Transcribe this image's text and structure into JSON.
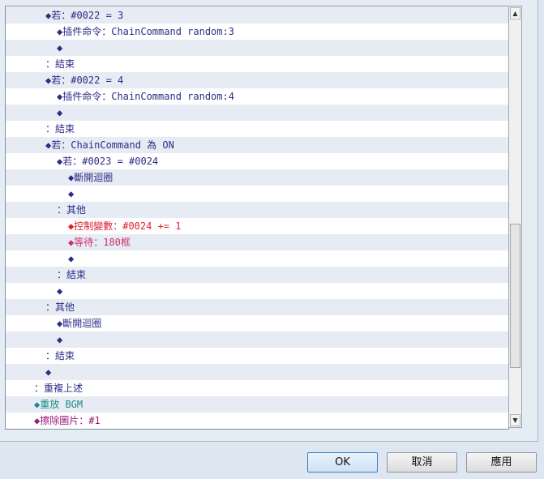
{
  "event_commands": [
    {
      "indent": 56,
      "text": "◆若：#0022 = 3",
      "color": "navy",
      "bg": "alt"
    },
    {
      "indent": 70,
      "text": "◆插件命令：ChainCommand random:3",
      "color": "navy",
      "bg": "plain"
    },
    {
      "indent": 70,
      "text": "◆",
      "color": "navy",
      "bg": "alt"
    },
    {
      "indent": 56,
      "text": "：結束",
      "color": "navy",
      "bg": "plain"
    },
    {
      "indent": 56,
      "text": "◆若：#0022 = 4",
      "color": "navy",
      "bg": "alt"
    },
    {
      "indent": 70,
      "text": "◆插件命令：ChainCommand random:4",
      "color": "navy",
      "bg": "plain"
    },
    {
      "indent": 70,
      "text": "◆",
      "color": "navy",
      "bg": "alt"
    },
    {
      "indent": 56,
      "text": "：結束",
      "color": "navy",
      "bg": "plain"
    },
    {
      "indent": 56,
      "text": "◆若：ChainCommand 為 ON",
      "color": "navy",
      "bg": "alt"
    },
    {
      "indent": 70,
      "text": "◆若：#0023 = #0024",
      "color": "navy",
      "bg": "plain"
    },
    {
      "indent": 84,
      "text": "◆斷開迴圈",
      "color": "navy",
      "bg": "alt"
    },
    {
      "indent": 84,
      "text": "◆",
      "color": "navy",
      "bg": "plain"
    },
    {
      "indent": 70,
      "text": "：其他",
      "color": "navy",
      "bg": "alt"
    },
    {
      "indent": 84,
      "text": "◆控制變數：#0024 += 1",
      "color": "red",
      "bg": "plain"
    },
    {
      "indent": 84,
      "text": "◆等待：180框",
      "color": "pink",
      "bg": "alt"
    },
    {
      "indent": 84,
      "text": "◆",
      "color": "navy",
      "bg": "plain"
    },
    {
      "indent": 70,
      "text": "：結束",
      "color": "navy",
      "bg": "alt"
    },
    {
      "indent": 70,
      "text": "◆",
      "color": "navy",
      "bg": "plain"
    },
    {
      "indent": 56,
      "text": "：其他",
      "color": "navy",
      "bg": "alt"
    },
    {
      "indent": 70,
      "text": "◆斷開迴圈",
      "color": "navy",
      "bg": "plain"
    },
    {
      "indent": 70,
      "text": "◆",
      "color": "navy",
      "bg": "alt"
    },
    {
      "indent": 56,
      "text": "：結束",
      "color": "navy",
      "bg": "plain"
    },
    {
      "indent": 56,
      "text": "◆",
      "color": "navy",
      "bg": "alt"
    },
    {
      "indent": 42,
      "text": "：重複上述",
      "color": "navy",
      "bg": "plain"
    },
    {
      "indent": 42,
      "text": "◆重放 BGM",
      "color": "teal",
      "bg": "alt"
    },
    {
      "indent": 42,
      "text": "◆擦除圖片：#1",
      "color": "magenta",
      "bg": "plain"
    }
  ],
  "scrollbar": {
    "up_arrow": "▲",
    "down_arrow": "▼"
  },
  "buttons": {
    "ok": "OK",
    "cancel": "取消",
    "apply": "應用"
  }
}
